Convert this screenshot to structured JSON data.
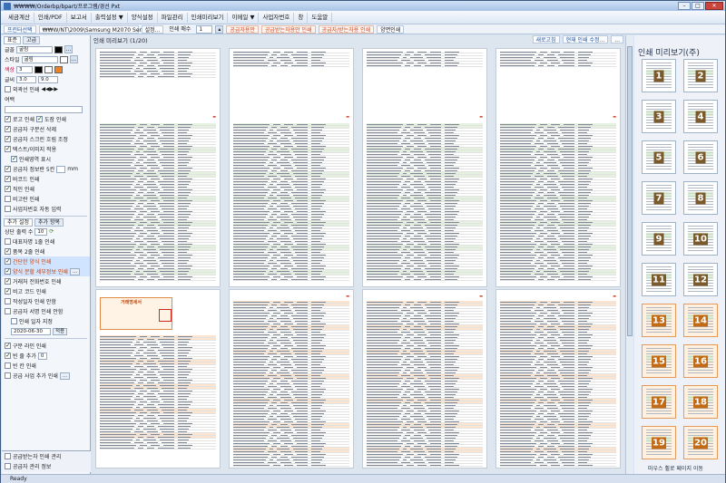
{
  "window": {
    "title": "₩₩₩₩/Orderbp/bpart/프로그램/경선 Pxt"
  },
  "menu": [
    "세금계산",
    "인쇄/PDF",
    "보고서",
    "출력설정 ▼",
    "양식설정",
    "파일관리",
    "인쇄미리보기",
    "이메일 ▼",
    "사업자번호",
    "창",
    "도움말"
  ],
  "toolbar": {
    "printer_label": "프린터선택",
    "printer_name": "₩₩W/NT\\2009\\Samsung M2070 Series",
    "setup_label": "설정...",
    "copies_label": "인쇄 매수",
    "copies_value": "1",
    "btn1": "공급자용만",
    "btn2": "공급받는자용만 인쇄",
    "btn3": "공급자/받는자용 인쇄",
    "btn4": "양면인쇄",
    "right1": "새로고침",
    "right2": "현재 인쇄 수정...",
    "right3": "..."
  },
  "left": {
    "tab1": "표준",
    "tab2": "고급",
    "font_label": "글꼴",
    "font_value": "굴림",
    "style_label": "스타일",
    "style_value": "굴림",
    "color_label": "색상",
    "size_value": "3",
    "size2_label": "글씨",
    "size2_value": "3.0",
    "size3_value": "9.0",
    "outline_label": "외곽선 인쇄",
    "margin_label": "여백",
    "options": [
      {
        "label": "로고 인쇄",
        "extra": "도장 인쇄",
        "on": true
      },
      {
        "label": "공급자 구분선 삭제",
        "on": true
      },
      {
        "label": "공급자 스크린 흐림 조정",
        "on": true
      },
      {
        "label": "텍스트/이미지 적용",
        "on": true
      },
      {
        "label": "인쇄영역 표시",
        "on": true
      },
      {
        "label": "공급자 정보란 5칸",
        "on": true,
        "unit": "mm"
      },
      {
        "label": "바코드 인쇄",
        "on": true
      },
      {
        "label": "직인 인쇄",
        "on": true
      },
      {
        "label": "비고란 인쇄",
        "on": false
      },
      {
        "label": "사업자번호 자동 입력",
        "on": false
      }
    ],
    "tab3": "추가 설정",
    "tab4": "추가 항목",
    "count_label": "상단 출력 수",
    "count_value": "10",
    "opt2": [
      {
        "label": "대표자명 1줄 인쇄",
        "on": false
      },
      {
        "label": "품목 2줄 인쇄",
        "on": true,
        "hl": false
      },
      {
        "label": "간단한 양식 인쇄",
        "on": true,
        "hl": true
      },
      {
        "label": "양식 분할 세부정보 인쇄",
        "on": true,
        "hl": true
      },
      {
        "label": "거래처 전화번호 인쇄",
        "on": true
      },
      {
        "label": "비고 코드 인쇄",
        "on": true
      },
      {
        "label": "작성일자 인쇄 안함",
        "on": false
      },
      {
        "label": "공급자 서명 인쇄 안함",
        "on": false
      },
      {
        "label": "인쇄 일자 지정",
        "on": false
      }
    ],
    "date_value": "2020-06-30",
    "apply_label": "적용",
    "opt3": [
      {
        "label": "구분 라인 인쇄",
        "on": true
      },
      {
        "label": "빈 줄 추가",
        "on": true,
        "num": "0"
      },
      {
        "label": "빈 칸 인쇄",
        "on": false
      },
      {
        "label": "공급 사업 추가 인쇄",
        "on": false
      }
    ],
    "bottom1": "공급받는자 인쇄 관리",
    "bottom2": "공급자 관리 정보"
  },
  "main": {
    "caption": "인쇄 미리보기 (1/20)",
    "page_right_label": "거래명세서"
  },
  "thumbs": {
    "title": "인쇄 미리보기(주)",
    "pages": [
      "1",
      "2",
      "3",
      "4",
      "5",
      "6",
      "7",
      "8",
      "9",
      "10",
      "11",
      "12",
      "13",
      "14",
      "15",
      "16",
      "17",
      "18",
      "19",
      "20"
    ],
    "footer": "마우스 휠로 페이지 이동"
  },
  "status": {
    "text": "Ready"
  }
}
